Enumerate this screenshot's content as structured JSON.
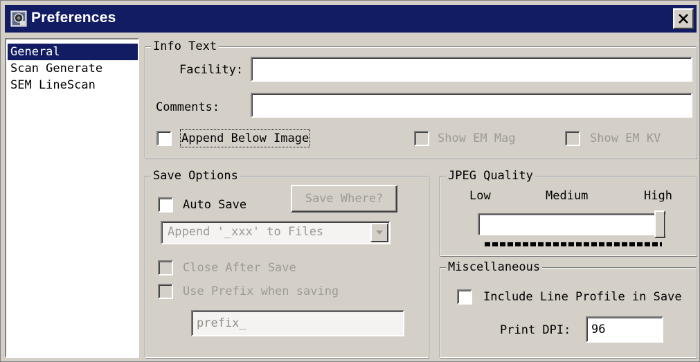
{
  "window": {
    "title": "Preferences",
    "close_icon": "close-icon",
    "app_icon": "preferences-app-icon"
  },
  "nav": {
    "items": [
      {
        "label": "General",
        "selected": true
      },
      {
        "label": "Scan Generate",
        "selected": false
      },
      {
        "label": "SEM LineScan",
        "selected": false
      }
    ]
  },
  "info_text": {
    "legend": "Info Text",
    "facility_label": "Facility:",
    "facility_value": "",
    "comments_label": "Comments:",
    "comments_value": "",
    "append_below_image_label": "Append Below Image",
    "append_below_image_checked": false,
    "show_em_mag_label": "Show EM Mag",
    "show_em_mag_checked": false,
    "show_em_kv_label": "Show EM KV",
    "show_em_kv_checked": false
  },
  "save_options": {
    "legend": "Save Options",
    "auto_save_label": "Auto Save",
    "auto_save_checked": false,
    "save_where_label": "Save Where?",
    "append_select_value": "Append '_xxx' to Files",
    "close_after_save_label": "Close After Save",
    "close_after_save_checked": false,
    "use_prefix_label": "Use Prefix when saving",
    "use_prefix_checked": false,
    "prefix_value": "prefix_"
  },
  "jpeg_quality": {
    "legend": "JPEG Quality",
    "low_label": "Low",
    "medium_label": "Medium",
    "high_label": "High",
    "slider_value": 1.0
  },
  "misc": {
    "legend": "Miscellaneous",
    "include_line_profile_label": "Include Line Profile in Save",
    "include_line_profile_checked": false,
    "print_dpi_label": "Print DPI:",
    "print_dpi_value": "96"
  },
  "colors": {
    "titlebar": "#121c63",
    "face": "#d4d0c8",
    "selection": "#121c63",
    "disabled_text": "#9d9a93"
  }
}
